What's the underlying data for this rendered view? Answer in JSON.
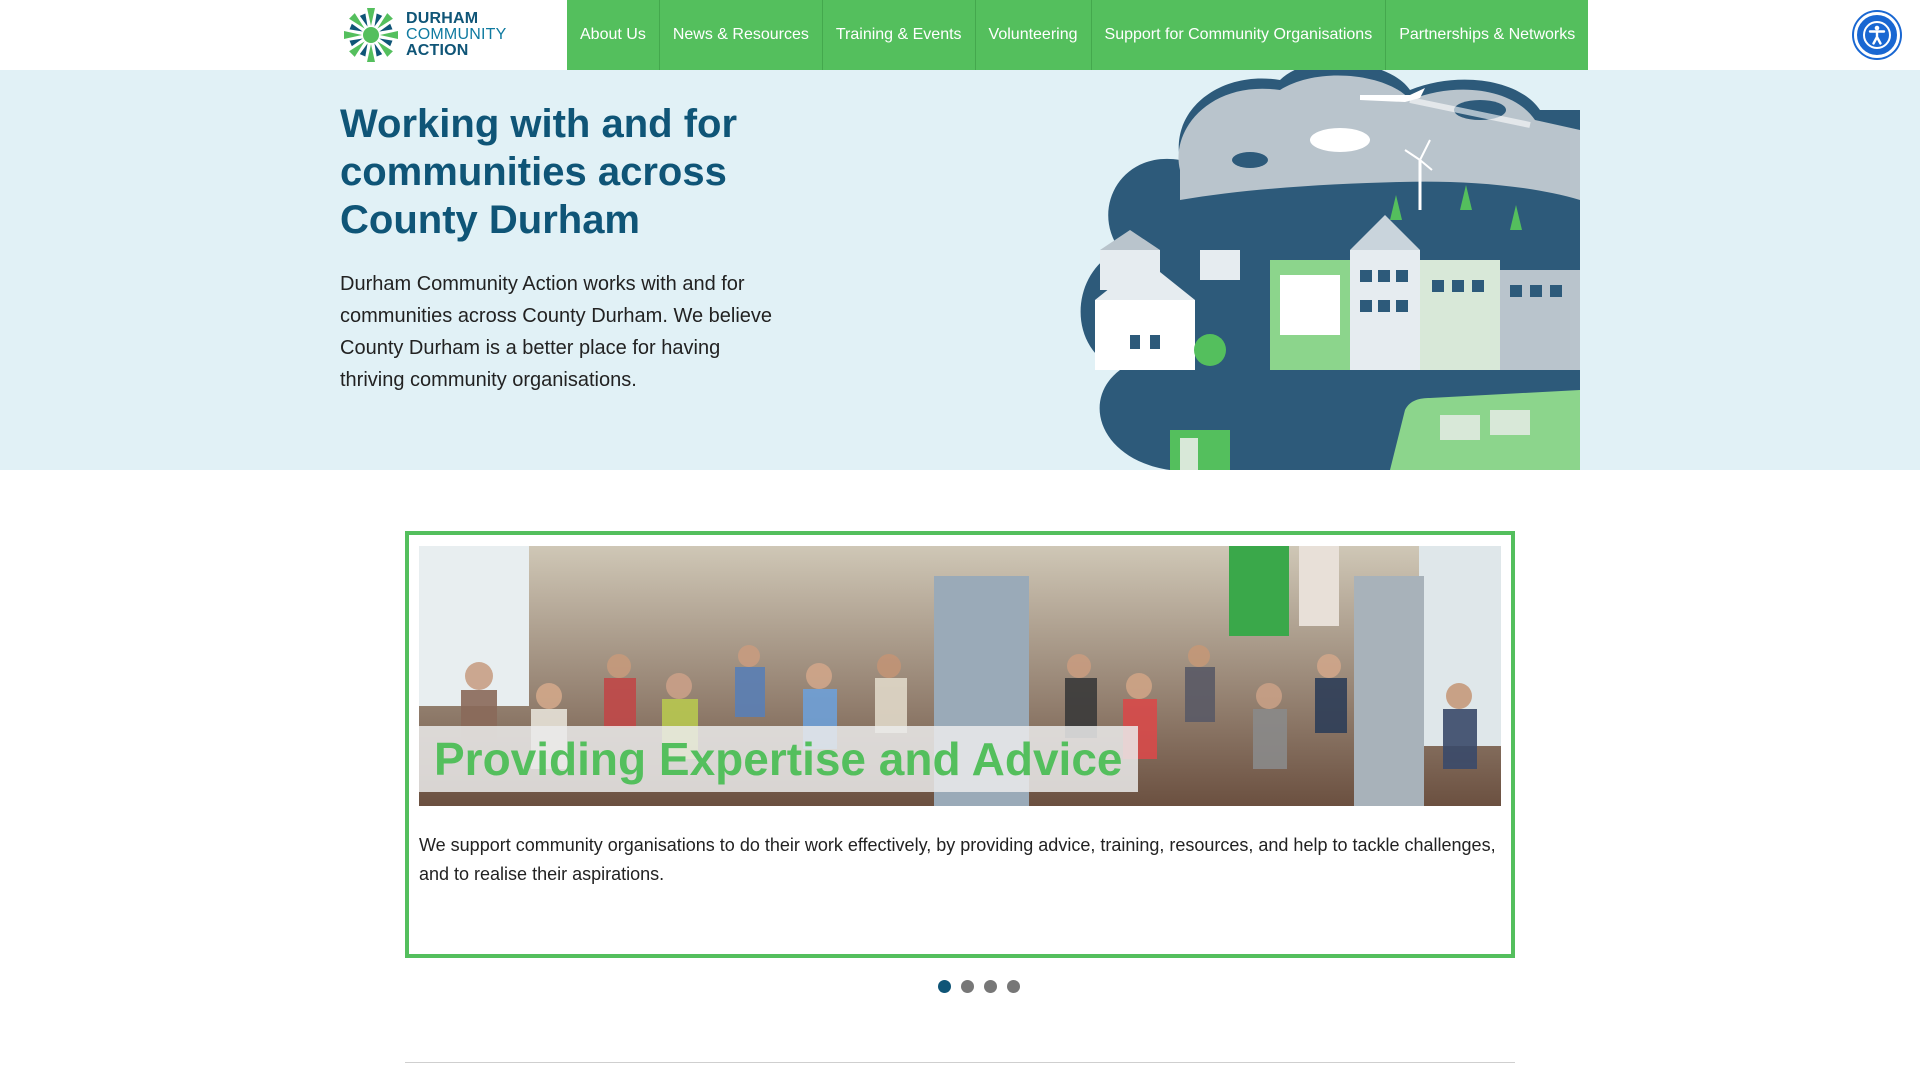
{
  "brand": {
    "line1": "DURHAM",
    "line2": "COMMUNITY",
    "line3": "ACTION",
    "primary_color": "#54bf5d",
    "dark_color": "#0f5577"
  },
  "nav": {
    "items": [
      {
        "label": "About Us"
      },
      {
        "label": "News & Resources"
      },
      {
        "label": "Training & Events"
      },
      {
        "label": "Volunteering"
      },
      {
        "label": "Support for Community Organisations"
      },
      {
        "label": "Partnerships & Networks"
      }
    ]
  },
  "accessibility": {
    "icon": "accessibility-icon"
  },
  "hero": {
    "title": "Working with and for communities across County Durham",
    "description": "Durham Community Action works with and for communities across County Durham. We believe County Durham is a better place for having thriving community organisations."
  },
  "slider": {
    "active_index": 0,
    "slide_count": 4,
    "caption": "Providing Expertise and Advice",
    "text": "We support community organisations to do their work effectively, by providing advice, training, resources, and help to tackle challenges, and to realise their aspirations."
  }
}
